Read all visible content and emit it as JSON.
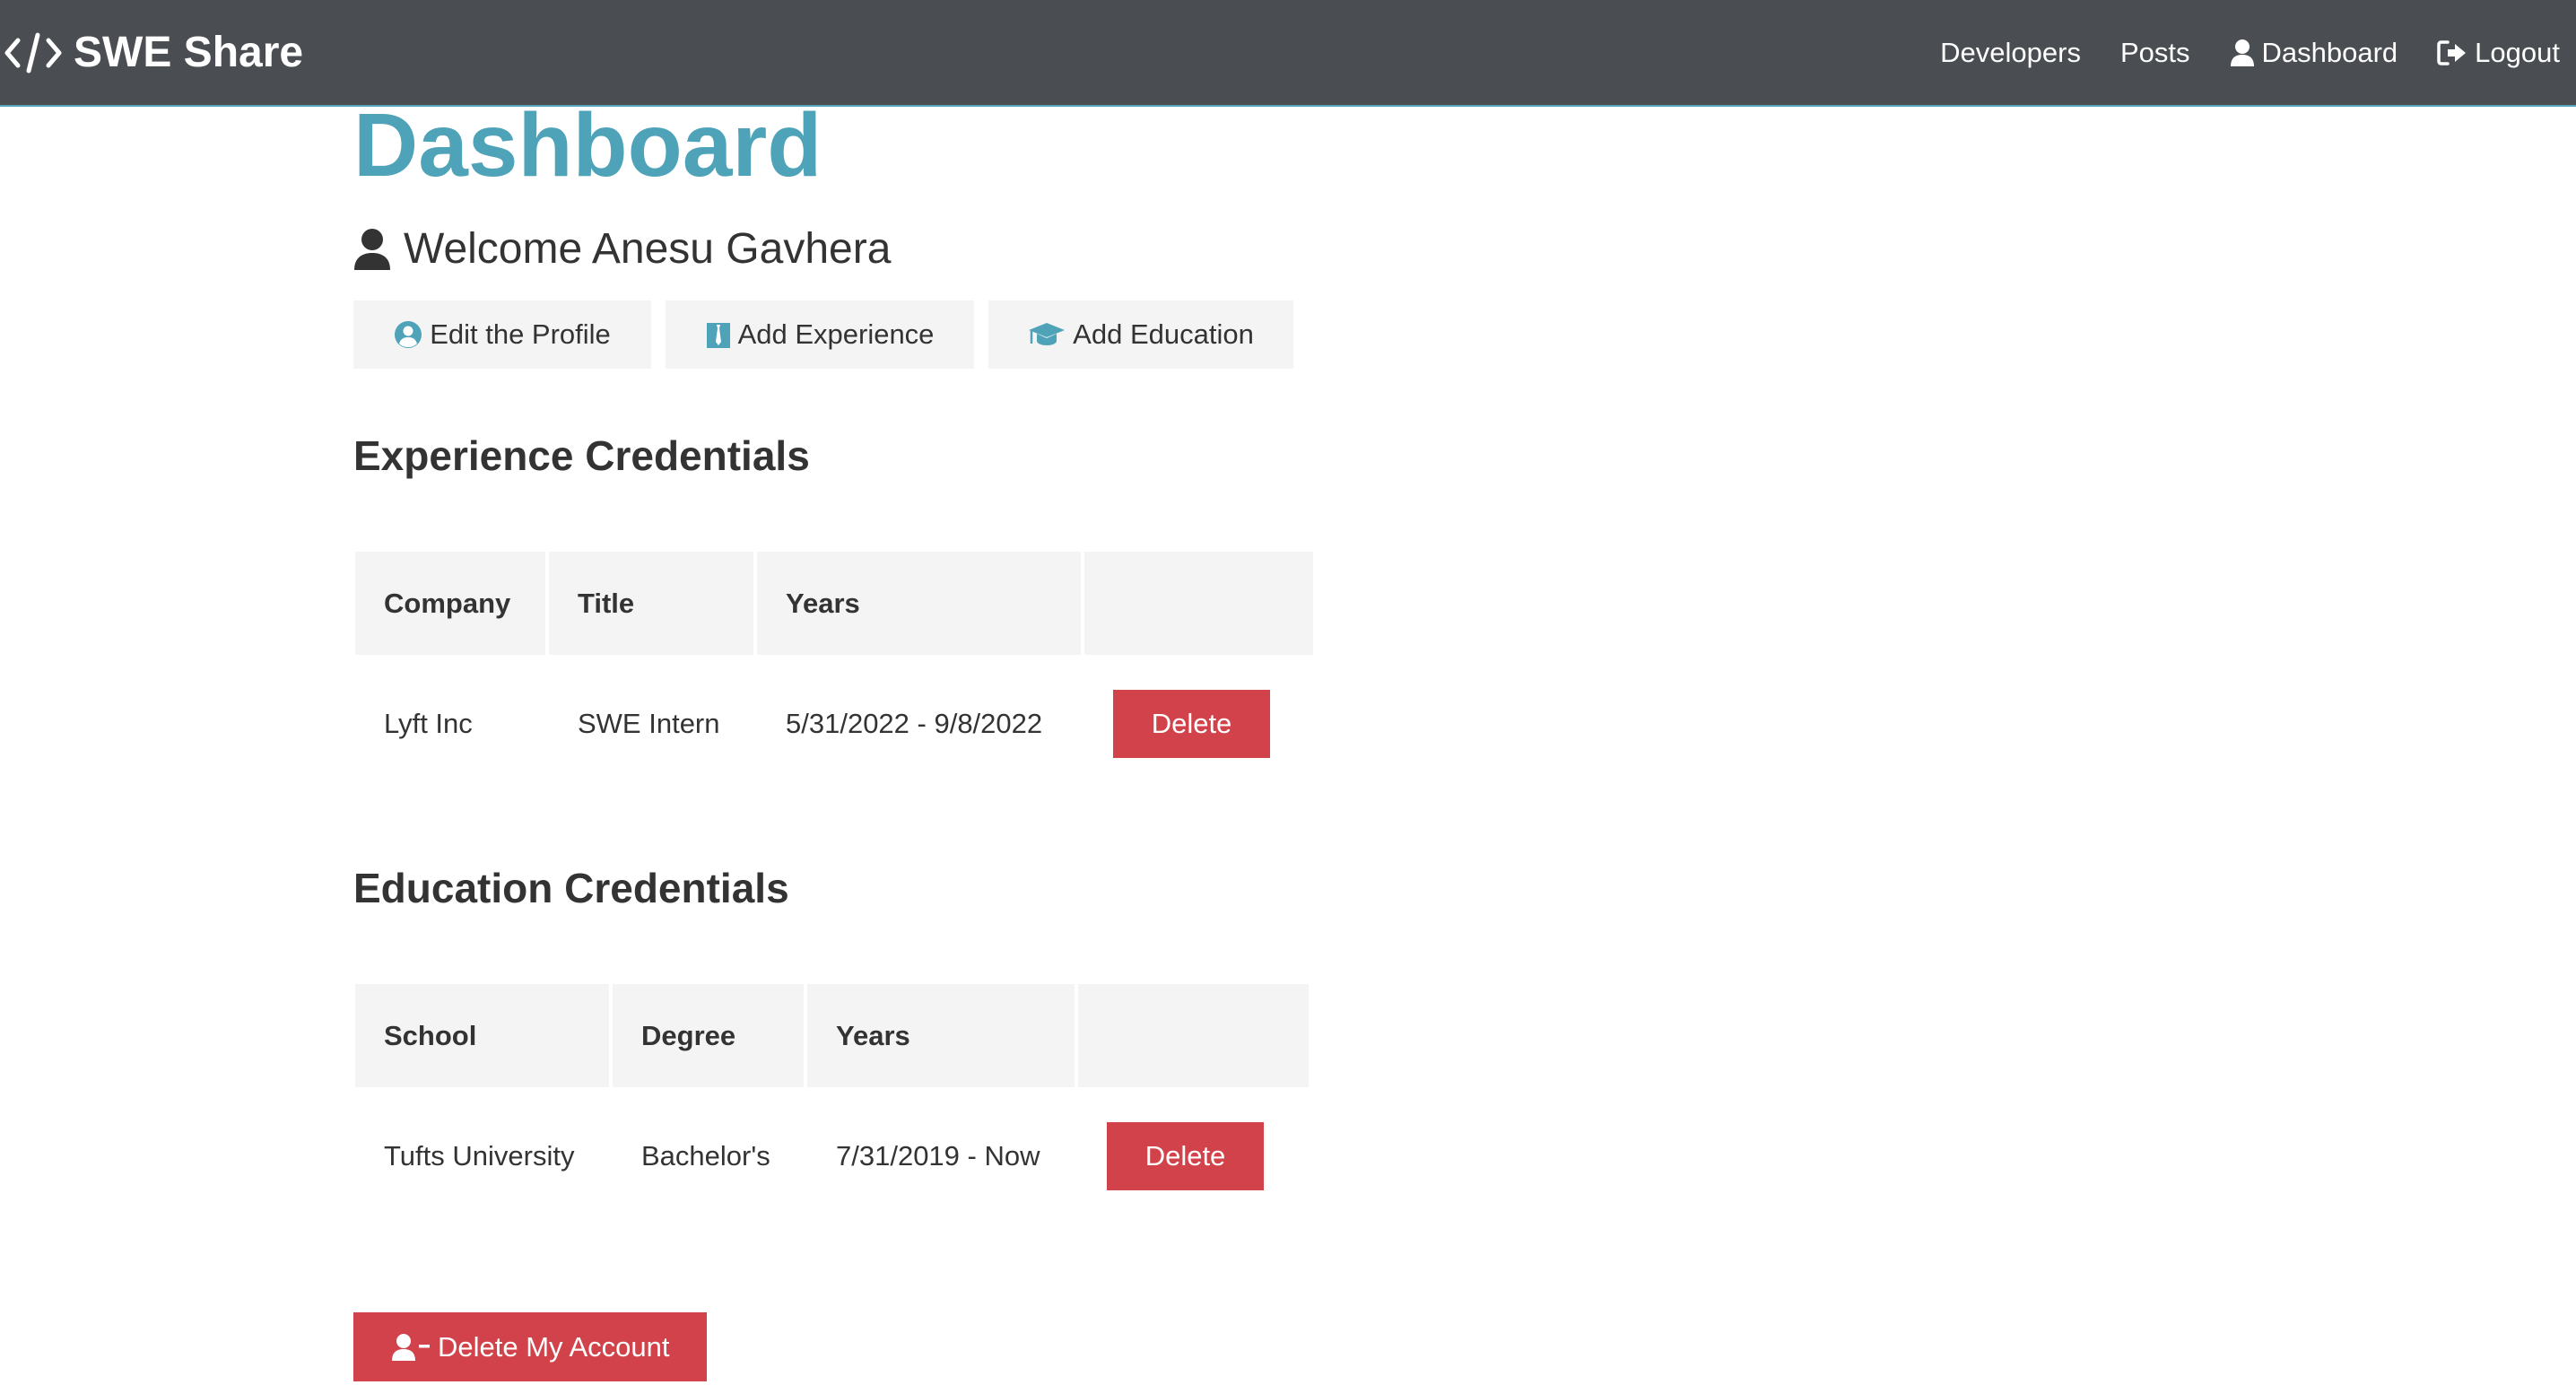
{
  "navbar": {
    "brand": "SWE Share",
    "links": [
      {
        "label": "Developers",
        "icon": ""
      },
      {
        "label": "Posts",
        "icon": ""
      },
      {
        "label": "Dashboard",
        "icon": "user-icon"
      },
      {
        "label": "Logout",
        "icon": "sign-out-icon"
      }
    ]
  },
  "page": {
    "title": "Dashboard",
    "welcome": "Welcome Anesu Gavhera"
  },
  "dashboard_actions": {
    "edit_profile": "Edit the Profile",
    "add_experience": "Add Experience",
    "add_education": "Add Education"
  },
  "experience": {
    "title": "Experience Credentials",
    "headers": [
      "Company",
      "Title",
      "Years",
      ""
    ],
    "rows": [
      {
        "company": "Lyft Inc",
        "title": "SWE Intern",
        "years": "5/31/2022 - 9/8/2022",
        "action": "Delete"
      }
    ]
  },
  "education": {
    "title": "Education Credentials",
    "headers": [
      "School",
      "Degree",
      "Years",
      ""
    ],
    "rows": [
      {
        "school": "Tufts University",
        "degree": "Bachelor's",
        "years": "7/31/2019 - Now",
        "action": "Delete"
      }
    ]
  },
  "delete_account": {
    "label": "Delete My Account"
  },
  "colors": {
    "navbar_bg": "#4a4e53",
    "primary": "#4fa3b8",
    "danger": "#d2424a",
    "light": "#f4f4f4"
  }
}
